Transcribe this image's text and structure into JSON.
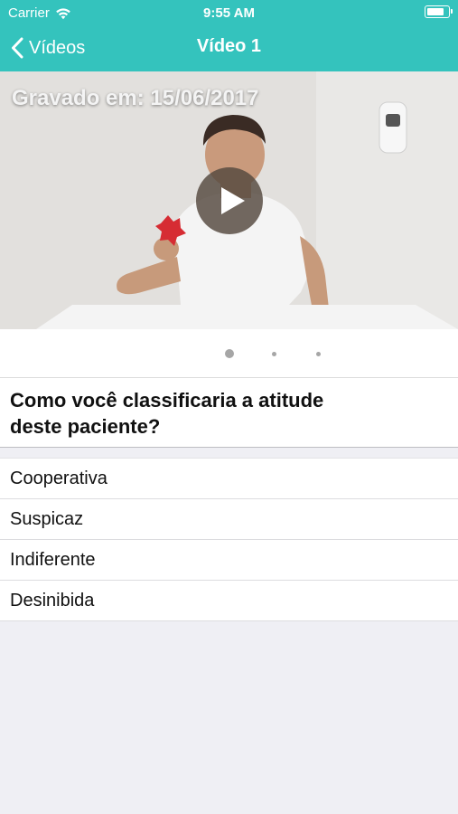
{
  "status_bar": {
    "carrier": "Carrier",
    "time": "9:55 AM",
    "battery_level": 0.85
  },
  "nav": {
    "back_label": "Vídeos",
    "title": "Vídeo 1",
    "accent_color": "#34c3bd"
  },
  "video": {
    "recorded_label": "Gravado em: 15/06/2017",
    "play_icon": "play-icon"
  },
  "pager": {
    "page_count": 3,
    "current_page": 1
  },
  "question": {
    "text": "Como você classificaria a atitude deste paciente?"
  },
  "options": [
    {
      "label": "Cooperativa"
    },
    {
      "label": "Suspicaz"
    },
    {
      "label": "Indiferente"
    },
    {
      "label": "Desinibida"
    }
  ]
}
